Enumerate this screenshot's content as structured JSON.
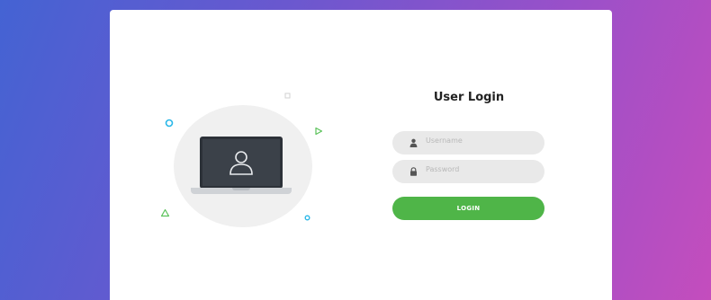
{
  "login": {
    "title": "User Login",
    "username_placeholder": "Username",
    "password_placeholder": "Password",
    "button_label": "LOGIN"
  },
  "icons": {
    "username": "user-icon",
    "password": "lock-icon",
    "avatar": "user-avatar-icon"
  },
  "colors": {
    "button": "#4fb548",
    "gradient_start": "#4463d3",
    "gradient_end": "#c44dbd"
  }
}
